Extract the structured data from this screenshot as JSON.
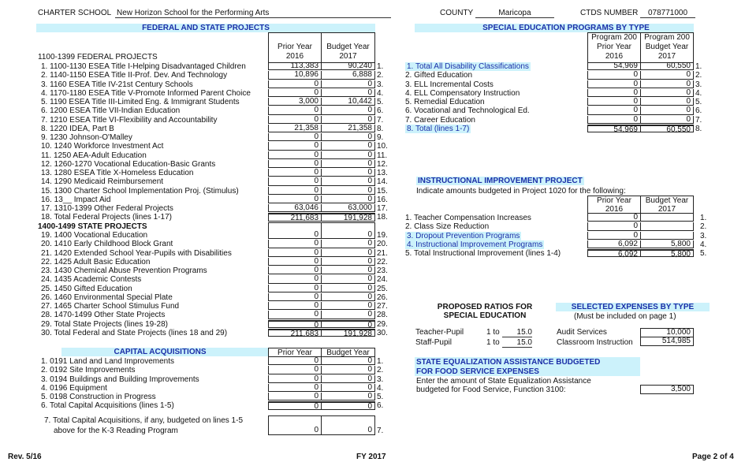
{
  "header": {
    "charter_label": "CHARTER SCHOOL",
    "charter_value": "New Horizon School for the Performing Arts",
    "county_label": "COUNTY",
    "county_value": "Maricopa",
    "ctds_label": "CTDS NUMBER",
    "ctds_value": "078771000"
  },
  "federal_state": {
    "title": "FEDERAL AND STATE PROJECTS",
    "col_prior": "Prior Year",
    "col_prior_year": "2016",
    "col_budget": "Budget Year",
    "col_budget_year": "2017",
    "federal_heading": "1100-1399 FEDERAL PROJECTS",
    "state_heading": "1400-1499 STATE PROJECTS",
    "federal_rows": [
      {
        "label": "1. 1100-1130  ESEA Title I-Helping Disadvantaged Children",
        "prior": "113,383",
        "budget": "90,240",
        "num": "1."
      },
      {
        "label": "2. 1140-1150  ESEA Title II-Prof. Dev. And Technology",
        "prior": "10,896",
        "budget": "6,888",
        "num": "2."
      },
      {
        "label": "3. 1160  ESEA Title IV-21st Century Schools",
        "prior": "0",
        "budget": "0",
        "num": "3."
      },
      {
        "label": "4. 1170-1180  ESEA Title V-Promote Informed Parent Choice",
        "prior": "0",
        "budget": "0",
        "num": "4."
      },
      {
        "label": "5. 1190  ESEA Title III-Limited Eng. & Immigrant Students",
        "prior": "3,000",
        "budget": "10,442",
        "num": "5."
      },
      {
        "label": "6. 1200  ESEA Title VII-Indian Education",
        "prior": "0",
        "budget": "0",
        "num": "6."
      },
      {
        "label": "7. 1210  ESEA Title VI-Flexibility and Accountability",
        "prior": "0",
        "budget": "0",
        "num": "7."
      },
      {
        "label": "8. 1220  IDEA, Part B",
        "prior": "21,358",
        "budget": "21,358",
        "num": "8."
      },
      {
        "label": "9. 1230  Johnson-O'Malley",
        "prior": "0",
        "budget": "0",
        "num": "9."
      },
      {
        "label": "10. 1240  Workforce Investment Act",
        "prior": "0",
        "budget": "0",
        "num": "10."
      },
      {
        "label": "11. 1250  AEA-Adult Education",
        "prior": "0",
        "budget": "0",
        "num": "11."
      },
      {
        "label": "12. 1260-1270  Vocational Education-Basic Grants",
        "prior": "0",
        "budget": "0",
        "num": "12."
      },
      {
        "label": "13. 1280  ESEA Title X-Homeless Education",
        "prior": "0",
        "budget": "0",
        "num": "13."
      },
      {
        "label": "14. 1290  Medicaid Reimbursement",
        "prior": "0",
        "budget": "0",
        "num": "14."
      },
      {
        "label": "15. 1300  Charter School Implementation Proj. (Stimulus)",
        "prior": "0",
        "budget": "0",
        "num": "15."
      },
      {
        "label": "16. 13__  Impact Aid",
        "prior": "0",
        "budget": "0",
        "num": "16."
      },
      {
        "label": "17. 1310-1399  Other Federal Projects",
        "prior": "63,046",
        "budget": "63,000",
        "num": "17."
      },
      {
        "label": "18. Total Federal Projects (lines 1-17)",
        "prior": "211,683",
        "budget": "191,928",
        "num": "18."
      }
    ],
    "state_rows": [
      {
        "label": "19. 1400  Vocational Education",
        "prior": "0",
        "budget": "0",
        "num": "19."
      },
      {
        "label": "20. 1410  Early Childhood Block Grant",
        "prior": "0",
        "budget": "0",
        "num": "20."
      },
      {
        "label": "21. 1420  Extended School Year-Pupils with Disabilities",
        "prior": "0",
        "budget": "0",
        "num": "21."
      },
      {
        "label": "22. 1425  Adult Basic Education",
        "prior": "0",
        "budget": "0",
        "num": "22."
      },
      {
        "label": "23. 1430  Chemical Abuse Prevention Programs",
        "prior": "0",
        "budget": "0",
        "num": "23."
      },
      {
        "label": "24. 1435  Academic Contests",
        "prior": "0",
        "budget": "0",
        "num": "24."
      },
      {
        "label": "25. 1450  Gifted Education",
        "prior": "0",
        "budget": "0",
        "num": "25."
      },
      {
        "label": "26. 1460  Environmental Special Plate",
        "prior": "0",
        "budget": "0",
        "num": "26."
      },
      {
        "label": "27. 1465  Charter School Stimulus Fund",
        "prior": "0",
        "budget": "0",
        "num": "27."
      },
      {
        "label": "28. 1470-1499  Other State Projects",
        "prior": "0",
        "budget": "0",
        "num": "28."
      },
      {
        "label": "29. Total State Projects (lines 19-28)",
        "prior": "0",
        "budget": "0",
        "num": "29."
      },
      {
        "label": "30. Total Federal and State Projects (lines 18 and 29)",
        "prior": "211,683",
        "budget": "191,928",
        "num": "30."
      }
    ]
  },
  "capital": {
    "title": "CAPITAL ACQUISITIONS",
    "col_prior": "Prior Year",
    "col_budget": "Budget Year",
    "rows": [
      {
        "label": "1. 0191  Land and Land Improvements",
        "prior": "0",
        "budget": "0",
        "num": "1."
      },
      {
        "label": "2. 0192  Site Improvements",
        "prior": "0",
        "budget": "0",
        "num": "2."
      },
      {
        "label": "3. 0194  Buildings and Building Improvements",
        "prior": "0",
        "budget": "0",
        "num": "3."
      },
      {
        "label": "4. 0196  Equipment",
        "prior": "0",
        "budget": "0",
        "num": "4."
      },
      {
        "label": "5. 0198  Construction in Progress",
        "prior": "0",
        "budget": "0",
        "num": "5."
      },
      {
        "label": "6. Total Capital Acquisitions (lines 1-5)",
        "prior": "0",
        "budget": "0",
        "num": "6."
      }
    ],
    "k3_line1": "7. Total Capital Acquisitions, if any, budgeted on lines 1-5",
    "k3_line2": "above for the K-3 Reading Program",
    "k3_prior": "0",
    "k3_budget": "0",
    "k3_num": "7."
  },
  "special_ed": {
    "title": "SPECIAL EDUCATION PROGRAMS BY TYPE",
    "col_prior": [
      "Program 200",
      "Prior Year",
      "2016"
    ],
    "col_budget": [
      "Program 200",
      "Budget Year",
      "2017"
    ],
    "rows": [
      {
        "label": "1. Total All Disability Classifications",
        "prior": "54,969",
        "budget": "60,550",
        "num": "1.",
        "highlight": true
      },
      {
        "label": "2. Gifted Education",
        "prior": "0",
        "budget": "0",
        "num": "2."
      },
      {
        "label": "3. ELL Incremental Costs",
        "prior": "0",
        "budget": "0",
        "num": "3."
      },
      {
        "label": "4. ELL Compensatory Instruction",
        "prior": "0",
        "budget": "0",
        "num": "4."
      },
      {
        "label": "5. Remedial Education",
        "prior": "0",
        "budget": "0",
        "num": "5."
      },
      {
        "label": "6. Vocational and Technological Ed.",
        "prior": "0",
        "budget": "0",
        "num": "6."
      },
      {
        "label": "7. Career Education",
        "prior": "0",
        "budget": "0",
        "num": "7."
      },
      {
        "label": "8. Total (lines 1-7)",
        "prior": "54,969",
        "budget": "60,550",
        "num": "8.",
        "highlight": true
      }
    ]
  },
  "instructional": {
    "title": "INSTRUCTIONAL IMPROVEMENT PROJECT",
    "instruction": "Indicate amounts budgeted in Project 1020 for the following:",
    "col_prior": "Prior Year",
    "col_prior_year": "2016",
    "col_budget": "Budget Year",
    "col_budget_year": "2017",
    "rows": [
      {
        "label": "1. Teacher Compensation Increases",
        "prior": "0",
        "budget": "",
        "num": "1."
      },
      {
        "label": "2. Class Size Reduction",
        "prior": "0",
        "budget": "",
        "num": "2."
      },
      {
        "label": "3. Dropout Prevention Programs",
        "prior": "0",
        "budget": "",
        "num": "3.",
        "highlight": true
      },
      {
        "label": "4. Instructional Improvement Programs",
        "prior": "6,092",
        "budget": "5,800",
        "num": "4.",
        "highlight": true
      },
      {
        "label": "5. Total Instructional Improvement (lines 1-4)",
        "prior": "6,092",
        "budget": "5,800",
        "num": "5."
      }
    ]
  },
  "ratios": {
    "title_line1": "PROPOSED RATIOS FOR",
    "title_line2": "SPECIAL EDUCATION",
    "rows": [
      {
        "label": "Teacher-Pupil",
        "prefix": "1 to",
        "value": "15.0"
      },
      {
        "label": "Staff-Pupil",
        "prefix": "1 to",
        "value": "15.0"
      }
    ]
  },
  "selected_expenses": {
    "title": "SELECTED EXPENSES BY TYPE",
    "subtitle": "(Must be included on page 1)",
    "rows": [
      {
        "label": "Audit Services",
        "value": "10,000"
      },
      {
        "label": "Classroom Instruction",
        "value": "514,985"
      }
    ]
  },
  "food_service": {
    "title_line1": "STATE EQUALIZATION ASSISTANCE BUDGETED",
    "title_line2": "FOR FOOD SERVICE EXPENSES",
    "text_line1": "Enter the amount of State Equalization Assistance",
    "text_line2": "budgeted for Food Service, Function 3100:",
    "value": "3,500"
  },
  "footer": {
    "rev": "Rev. 5/16",
    "fy": "FY 2017",
    "page": "Page 2 of 4"
  },
  "colors": {
    "band": "#ccf2fb",
    "title_blue": "#1b2fa8"
  }
}
